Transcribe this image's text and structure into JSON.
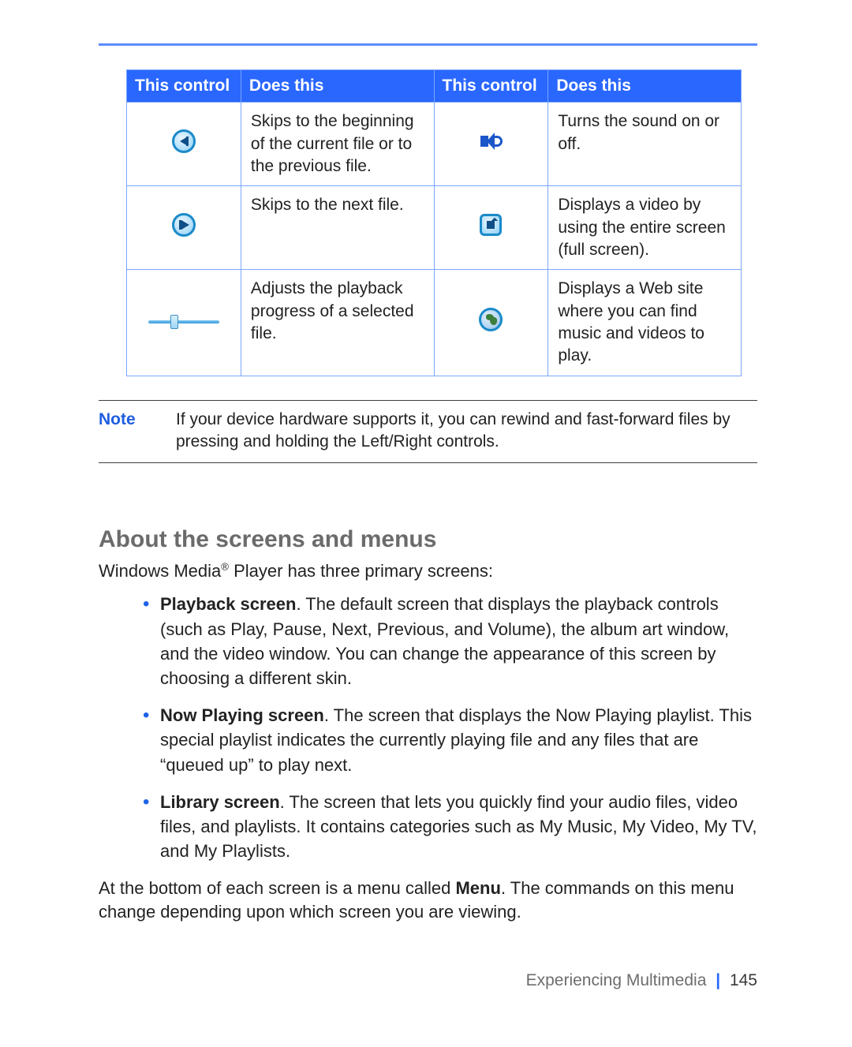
{
  "table": {
    "headers": {
      "c1": "This control",
      "c2": "Does this",
      "c3": "This control",
      "c4": "Does this"
    },
    "rows": [
      {
        "icon_left": "skip-previous-icon",
        "desc_left": "Skips to the beginning of the current file or to the previous file.",
        "icon_right": "sound-toggle-icon",
        "desc_right": "Turns the sound on or off."
      },
      {
        "icon_left": "skip-next-icon",
        "desc_left": "Skips to the next file.",
        "icon_right": "fullscreen-icon",
        "desc_right": "Displays a video by using the entire screen (full screen)."
      },
      {
        "icon_left": "progress-slider-icon",
        "desc_left": "Adjusts the playback progress of a selected file.",
        "icon_right": "web-globe-icon",
        "desc_right": "Displays a Web site where you can find music and videos to play."
      }
    ]
  },
  "note": {
    "label": "Note",
    "text": "If your device hardware supports it, you can rewind and fast-forward files by pressing and holding the Left/Right controls."
  },
  "section_heading": "About the screens and menus",
  "intro_prefix": "Windows Media",
  "intro_suffix": " Player has three primary screens:",
  "bullets": [
    {
      "title": "Playback screen",
      "text": ". The default screen that displays the playback controls (such as Play, Pause, Next, Previous, and Volume), the album art window, and the video window. You can change the appearance of this screen by choosing a different skin."
    },
    {
      "title": "Now Playing screen",
      "text": ". The screen that displays the Now Playing playlist. This special playlist indicates the currently playing file and any files that are “queued up” to play next."
    },
    {
      "title": "Library screen",
      "text": ". The screen that lets you quickly find your audio files, video files, and playlists. It contains categories such as My Music, My Video, My TV, and My Playlists."
    }
  ],
  "closing_pre": "At the bottom of each screen is a menu called ",
  "closing_bold": "Menu",
  "closing_post": ". The commands on this menu change depending upon which screen you are viewing.",
  "footer": {
    "chapter": "Experiencing Multimedia",
    "page": "145"
  }
}
